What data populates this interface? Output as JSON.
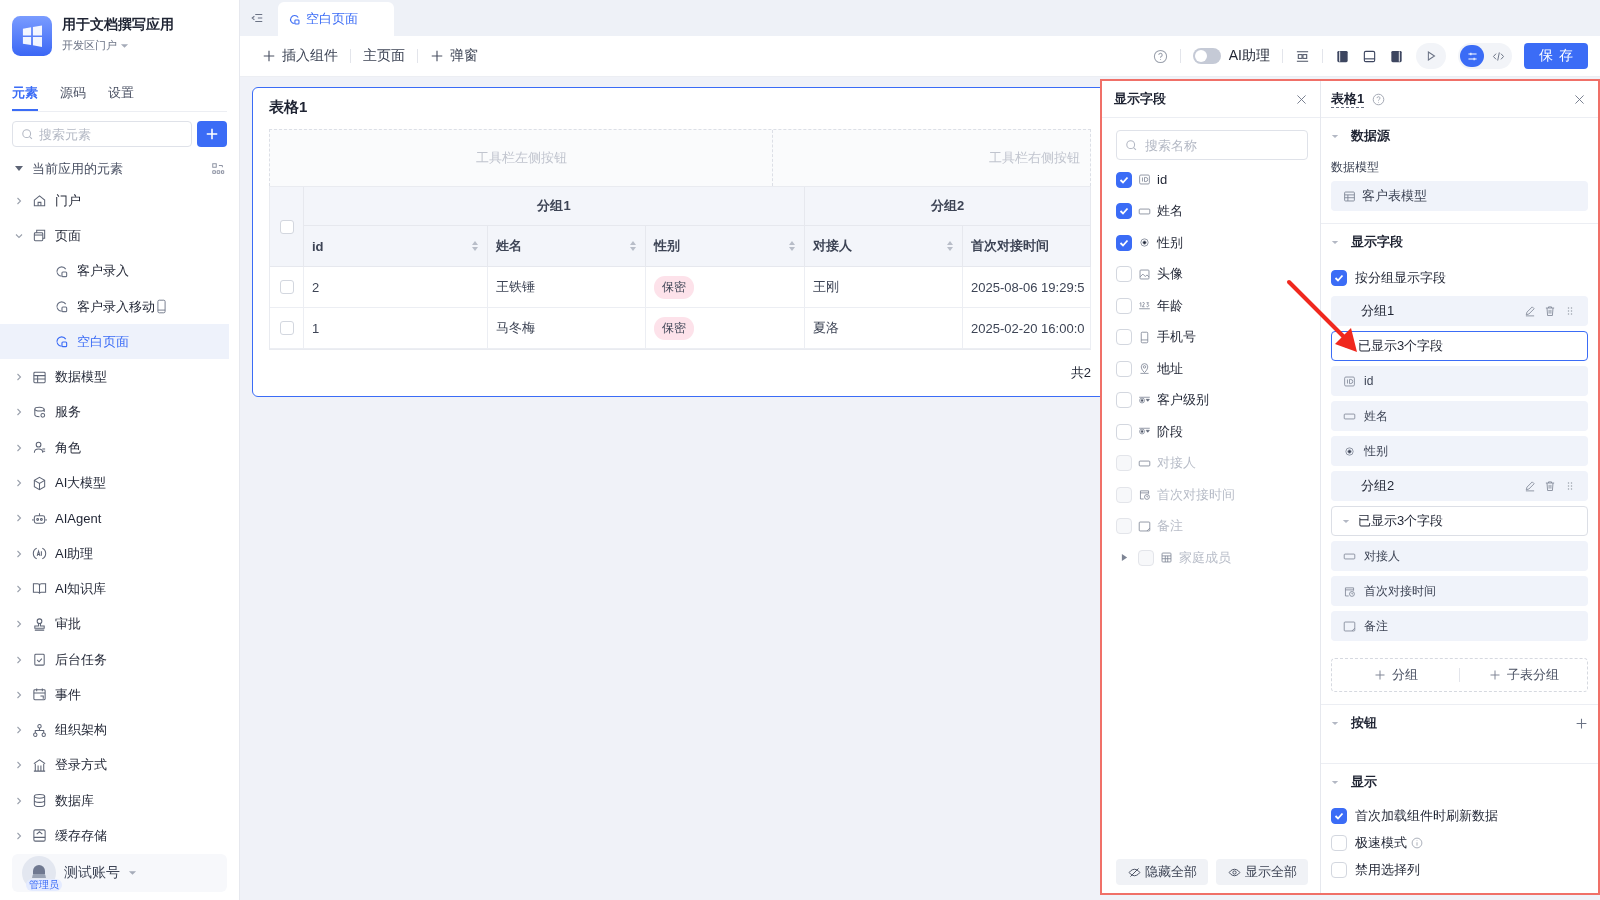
{
  "app": {
    "name": "用于文档撰写应用",
    "portal": "开发区门户"
  },
  "sidebar_tabs": [
    {
      "label": "元素",
      "selected": true
    },
    {
      "label": "源码",
      "selected": false
    },
    {
      "label": "设置",
      "selected": false
    }
  ],
  "element_search": {
    "placeholder": "搜索元素"
  },
  "tree": {
    "title": "当前应用的元素",
    "expanded": true,
    "items": [
      {
        "label": "门户",
        "kind": "home",
        "expanded": false
      },
      {
        "label": "页面",
        "kind": "page",
        "expanded": true,
        "children": [
          {
            "label": "客户录入",
            "kind": "page-item",
            "selected": false
          },
          {
            "label": "客户录入移动",
            "kind": "mobile-page",
            "selected": false
          },
          {
            "label": "空白页面",
            "kind": "page-item",
            "selected": true
          }
        ]
      },
      {
        "label": "数据模型",
        "kind": "table",
        "expanded": false
      },
      {
        "label": "服务",
        "kind": "service",
        "expanded": false
      },
      {
        "label": "角色",
        "kind": "role",
        "expanded": false
      },
      {
        "label": "AI大模型",
        "kind": "ai-model",
        "expanded": false
      },
      {
        "label": "AIAgent",
        "kind": "robot",
        "expanded": false
      },
      {
        "label": "AI助理",
        "kind": "ai",
        "expanded": false
      },
      {
        "label": "AI知识库",
        "kind": "book",
        "expanded": false
      },
      {
        "label": "审批",
        "kind": "approve",
        "expanded": false
      },
      {
        "label": "后台任务",
        "kind": "task",
        "expanded": false
      },
      {
        "label": "事件",
        "kind": "event",
        "expanded": false
      },
      {
        "label": "组织架构",
        "kind": "org",
        "expanded": false
      },
      {
        "label": "登录方式",
        "kind": "login",
        "expanded": false
      },
      {
        "label": "数据库",
        "kind": "db",
        "expanded": false
      },
      {
        "label": "缓存存储",
        "kind": "storage",
        "expanded": false
      }
    ]
  },
  "user": {
    "name": "测试账号",
    "role": "管理员"
  },
  "tabs": [
    {
      "label": "空白页面",
      "selected": true
    }
  ],
  "toolbar": {
    "actions": [
      {
        "label": "插入组件",
        "kind": "add"
      },
      {
        "label": "主页面",
        "kind": "plain"
      },
      {
        "label": "弹窗",
        "kind": "add"
      }
    ],
    "assistant": {
      "label": "AI助理",
      "on": false
    },
    "save": "保存"
  },
  "table_card": {
    "title": "表格1",
    "toolbar_left": "工具栏左侧按钮",
    "toolbar_right": "工具栏右侧按钮",
    "groups": [
      {
        "label": "分组1",
        "columns": [
          {
            "label": "id",
            "kind": "text",
            "sortable": true
          },
          {
            "label": "姓名",
            "kind": "text",
            "sortable": true
          },
          {
            "label": "性别",
            "kind": "tag",
            "sortable": true
          }
        ]
      },
      {
        "label": "分组2",
        "columns": [
          {
            "label": "对接人",
            "kind": "text",
            "sortable": true
          },
          {
            "label": "首次对接时间",
            "kind": "text",
            "sortable": false
          }
        ]
      }
    ],
    "select_all": {
      "checked": false
    },
    "rows": [
      {
        "checked": false,
        "cells": [
          "2",
          "王铁锤",
          "保密",
          "王刚",
          "2025-08-06 19:29:5"
        ]
      },
      {
        "checked": false,
        "cells": [
          "1",
          "马冬梅",
          "保密",
          "夏洛",
          "2025-02-20 16:00:0"
        ]
      }
    ],
    "footer": "共2"
  },
  "field_panel": {
    "title": "显示字段",
    "search": {
      "placeholder": "搜索名称"
    },
    "fields": [
      {
        "label": "id",
        "kind": "id",
        "checked": true,
        "disabled": false
      },
      {
        "label": "姓名",
        "kind": "text",
        "checked": true,
        "disabled": false
      },
      {
        "label": "性别",
        "kind": "radio",
        "checked": true,
        "disabled": false
      },
      {
        "label": "头像",
        "kind": "image",
        "checked": false,
        "disabled": false
      },
      {
        "label": "年龄",
        "kind": "number",
        "checked": false,
        "disabled": false
      },
      {
        "label": "手机号",
        "kind": "phone",
        "checked": false,
        "disabled": false
      },
      {
        "label": "地址",
        "kind": "location",
        "checked": false,
        "disabled": false
      },
      {
        "label": "客户级别",
        "kind": "select",
        "checked": false,
        "disabled": false
      },
      {
        "label": "阶段",
        "kind": "select",
        "checked": false,
        "disabled": false
      },
      {
        "label": "对接人",
        "kind": "text",
        "checked": false,
        "disabled": true
      },
      {
        "label": "首次对接时间",
        "kind": "date",
        "checked": false,
        "disabled": true
      },
      {
        "label": "备注",
        "kind": "textarea",
        "checked": false,
        "disabled": true
      },
      {
        "label": "家庭成员",
        "kind": "subtable",
        "checked": false,
        "disabled": true,
        "expanded": false
      }
    ],
    "buttons": [
      {
        "label": "隐藏全部",
        "kind": "hide"
      },
      {
        "label": "显示全部",
        "kind": "show"
      }
    ]
  },
  "properties": {
    "title": "表格1",
    "datasource": {
      "title": "数据源",
      "expanded": true,
      "model_label": "数据模型",
      "model": "客户表模型"
    },
    "display_fields": {
      "title": "显示字段",
      "expanded": true,
      "by_group": {
        "label": "按分组显示字段",
        "checked": true
      },
      "groups": [
        {
          "name": "分组1",
          "summary": "已显示3个字段",
          "focused": true,
          "fields": [
            {
              "label": "id",
              "kind": "id"
            },
            {
              "label": "姓名",
              "kind": "text"
            },
            {
              "label": "性别",
              "kind": "radio"
            }
          ]
        },
        {
          "name": "分组2",
          "summary": "已显示3个字段",
          "focused": false,
          "fields": [
            {
              "label": "对接人",
              "kind": "text"
            },
            {
              "label": "首次对接时间",
              "kind": "date"
            },
            {
              "label": "备注",
              "kind": "textarea"
            }
          ]
        }
      ],
      "add_buttons": [
        "分组",
        "子表分组"
      ]
    },
    "buttons_section": {
      "title": "按钮",
      "expanded": true
    },
    "display": {
      "title": "显示",
      "expanded": true,
      "options": [
        {
          "label": "首次加载组件时刷新数据",
          "checked": true,
          "info": false
        },
        {
          "label": "极速模式",
          "checked": false,
          "info": true
        },
        {
          "label": "禁用选择列",
          "checked": false,
          "info": false
        }
      ]
    }
  }
}
